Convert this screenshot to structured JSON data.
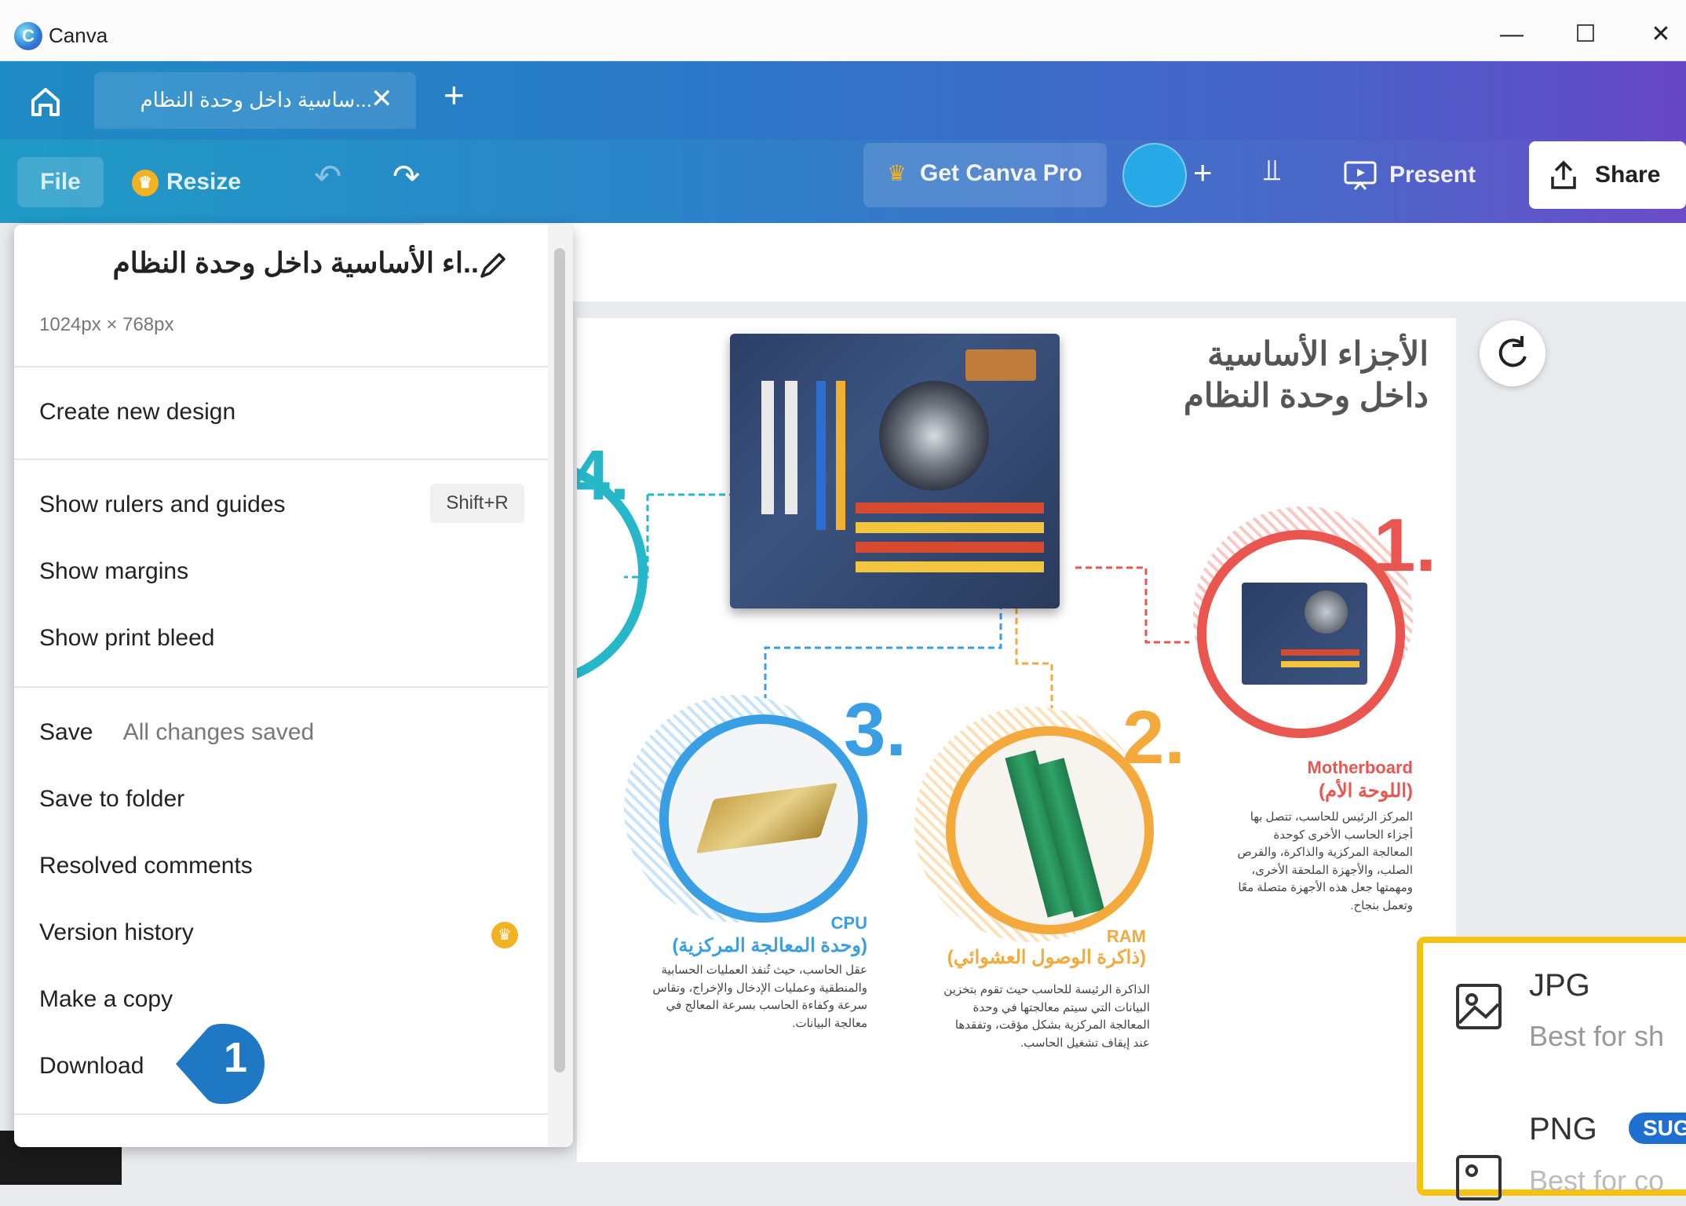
{
  "window": {
    "app_title": "Canva",
    "minimize": "—",
    "maximize": "☐",
    "close": "✕"
  },
  "tabs": {
    "doc_title": "...ساسية داخل وحدة النظام",
    "close": "✕",
    "new_tab": "+"
  },
  "toolbar": {
    "file_label": "File",
    "resize_label": "Resize",
    "pro_label": "Get Canva Pro",
    "collab_plus": "+",
    "present_label": "Present",
    "share_label": "Share"
  },
  "file_menu": {
    "design_title": "..اء الأساسية داخل وحدة النظام",
    "dimensions": "1024px × 768px",
    "create_new": "Create new design",
    "show_rulers": "Show rulers and guides",
    "rulers_shortcut": "Shift+R",
    "show_margins": "Show margins",
    "show_bleed": "Show print bleed",
    "save": "Save",
    "save_status": "All changes saved",
    "save_to_folder": "Save to folder",
    "resolved_comments": "Resolved comments",
    "version_history": "Version history",
    "make_copy": "Make a copy",
    "download": "Download",
    "step_badge": "1"
  },
  "slide": {
    "title_line1": "الأجزاء الأساسية",
    "title_line2": "داخل وحدة النظام",
    "item1": {
      "number": "1.",
      "name_en": "Motherboard",
      "name_ar": "(اللوحة الأم)",
      "body": "المركز الرئيس للحاسب، تتصل بها أجزاء الحاسب الأخرى كوحدة المعالجة المركزية والذاكرة، والقرص الصلب، والأجهزة الملحقة الأخرى، ومهمتها جعل هذه الأجهزة متصلة معًا وتعمل بنجاح."
    },
    "item2": {
      "number": "2.",
      "name_en": "RAM",
      "name_ar": "(ذاكرة الوصول العشوائي)",
      "body": "الذاكرة الرئيسة للحاسب حيث تقوم بتخزين البيانات التي سيتم معالجتها في وحدة المعالجة المركزية بشكل مؤقت، وتفقدها عند إيقاف تشغيل الحاسب."
    },
    "item3": {
      "number": "3.",
      "name_en": "CPU",
      "name_ar": "(وحدة المعالجة المركزية)",
      "body": "عقل الحاسب، حيث تُنفذ العمليات الحسابية والمنطقية وعمليات الإدخال والإخراج، وتقاس سرعة وكفاءة الحاسب بسرعة المعالج في معالجة البيانات."
    },
    "item4": {
      "number": "4."
    }
  },
  "export_panel": {
    "jpg_title": "JPG",
    "jpg_sub": "Best for sh",
    "png_title": "PNG",
    "png_badge": "SUG",
    "png_sub": "Best for co"
  },
  "colors": {
    "accent_red": "#e8564f",
    "accent_orange": "#f3a93b",
    "accent_blue": "#3a9ee4",
    "accent_teal": "#26b7c9",
    "highlight_yellow": "#f4c20f",
    "badge_blue": "#1f78c4"
  },
  "icons": [
    "canva-logo-icon",
    "home-icon",
    "crown-icon",
    "undo-icon",
    "redo-icon",
    "stats-icon",
    "present-icon",
    "share-icon",
    "pencil-icon",
    "regenerate-icon",
    "image-icon"
  ]
}
